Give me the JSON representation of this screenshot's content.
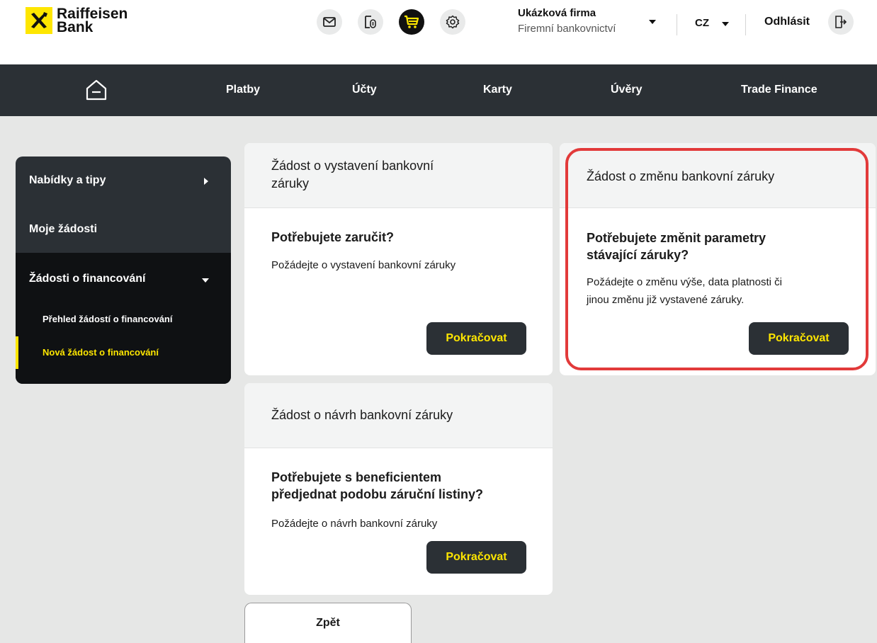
{
  "brand": {
    "line1": "Raiffeisen",
    "line2": "Bank",
    "yellow": "#fee600",
    "dark": "#2b3035"
  },
  "header": {
    "icons": [
      "mail-icon",
      "document-icon",
      "cart-icon",
      "settings-icon"
    ],
    "company_name": "Ukázková firma",
    "company_sub": "Firemní bankovnictví",
    "language": "CZ",
    "logout": "Odhlásit"
  },
  "nav": {
    "items": [
      "Platby",
      "Účty",
      "Karty",
      "Úvěry",
      "Trade Finance"
    ]
  },
  "sidebar": {
    "items": [
      "Nabídky a tipy",
      "Moje žádosti",
      "Žádosti o financování"
    ],
    "subitems": [
      "Přehled žádostí o financování",
      "Nová žádost o financování"
    ]
  },
  "cards": [
    {
      "title_lines": [
        "Žádost o vystavení bankovní",
        "záruky"
      ],
      "question_lines": [
        "Potřebujete zaručit?"
      ],
      "description_lines": [
        "Požádejte o vystavení bankovní záruky"
      ],
      "button": "Pokračovat"
    },
    {
      "title_lines": [
        "Žádost o změnu bankovní záruky"
      ],
      "question_lines": [
        "Potřebujete změnit parametry",
        "stávající záruky?"
      ],
      "description_lines": [
        "Požádejte o změnu výše, data platnosti či",
        "jinou změnu již vystavené záruky."
      ],
      "button": "Pokračovat"
    },
    {
      "title_lines": [
        "Žádost o návrh bankovní záruky"
      ],
      "question_lines": [
        "Potřebujete s beneficientem",
        "předjednat podobu záruční listiny?"
      ],
      "description_lines": [
        "Požádejte o návrh bankovní záruky"
      ],
      "button": "Pokračovat"
    }
  ],
  "back_button": "Zpět",
  "highlight_color": "#e23a3a"
}
